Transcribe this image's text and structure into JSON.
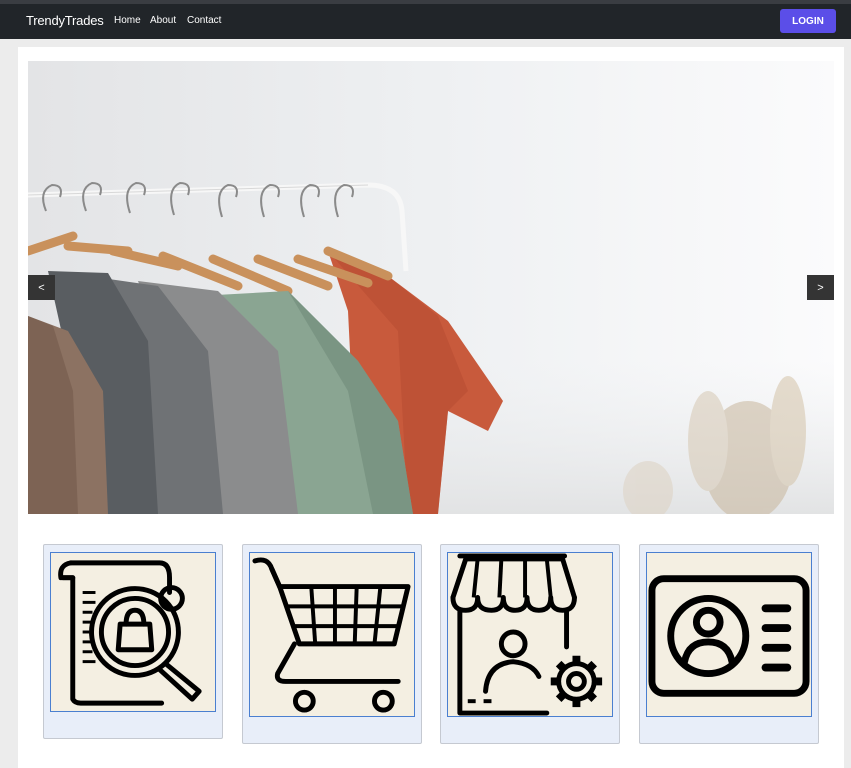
{
  "navbar": {
    "brand": "TrendyTrades",
    "links": [
      "Home",
      "About",
      "Contact"
    ],
    "login_label": "LOGIN",
    "login_color": "#5b4ee8",
    "background": "#212529"
  },
  "carousel": {
    "prev_label": "<",
    "next_label": ">",
    "image": "clothing-rack-photo"
  },
  "cards": [
    {
      "icon": "document-search-bag-icon"
    },
    {
      "icon": "shopping-cart-icon"
    },
    {
      "icon": "shop-vendor-gear-icon"
    },
    {
      "icon": "id-card-icon"
    }
  ]
}
